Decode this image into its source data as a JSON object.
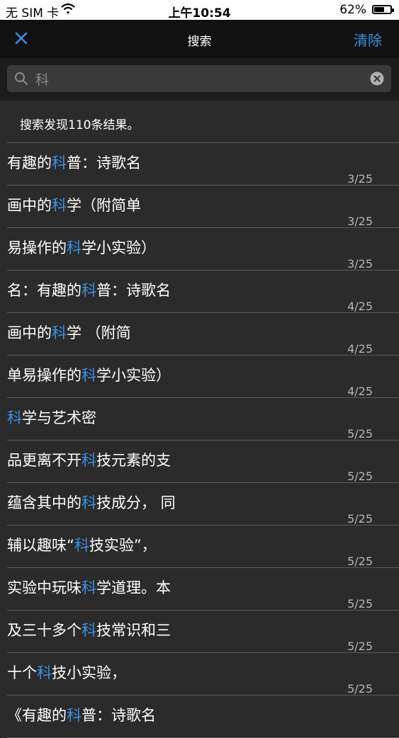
{
  "status_bar": {
    "carrier": "无 SIM 卡",
    "time": "上午10:54",
    "battery": "62%",
    "battery_level": 0.62
  },
  "nav": {
    "title": "搜索",
    "clear_label": "清除",
    "close_icon": "close-x-icon"
  },
  "search": {
    "query": "科",
    "icon": "magnifier-icon",
    "clear_icon": "clear-circle-icon"
  },
  "summary": "搜索发现110条结果。",
  "colors": {
    "accent": "#3b8fe3",
    "background": "#2b2b2b",
    "navbar": "#111111"
  },
  "results": [
    {
      "before": "有趣的",
      "match": "科",
      "after": "普：诗歌名",
      "page": "3/25"
    },
    {
      "before": "画中的",
      "match": "科",
      "after": "学（附简单",
      "page": "3/25"
    },
    {
      "before": "易操作的",
      "match": "科",
      "after": "学小实验）",
      "page": "3/25"
    },
    {
      "before": "名：有趣的",
      "match": "科",
      "after": "普：诗歌名",
      "page": "4/25"
    },
    {
      "before": "画中的",
      "match": "科",
      "after": "学 （附简",
      "page": "4/25"
    },
    {
      "before": "单易操作的",
      "match": "科",
      "after": "学小实验）",
      "page": "4/25"
    },
    {
      "before": "",
      "match": "科",
      "after": "学与艺术密",
      "page": "5/25"
    },
    {
      "before": "品更离不开",
      "match": "科",
      "after": "技元素的支",
      "page": "5/25"
    },
    {
      "before": "蕴含其中的",
      "match": "科",
      "after": "技成分， 同",
      "page": "5/25"
    },
    {
      "before": "辅以趣味“",
      "match": "科",
      "after": "技实验”，",
      "page": "5/25"
    },
    {
      "before": "实验中玩味",
      "match": "科",
      "after": "学道理。本",
      "page": "5/25"
    },
    {
      "before": "及三十多个",
      "match": "科",
      "after": "技常识和三",
      "page": "5/25"
    },
    {
      "before": "十个",
      "match": "科",
      "after": "技小实验，",
      "page": "5/25"
    },
    {
      "before": "《有趣的",
      "match": "科",
      "after": "普：诗歌名",
      "page": ""
    }
  ]
}
